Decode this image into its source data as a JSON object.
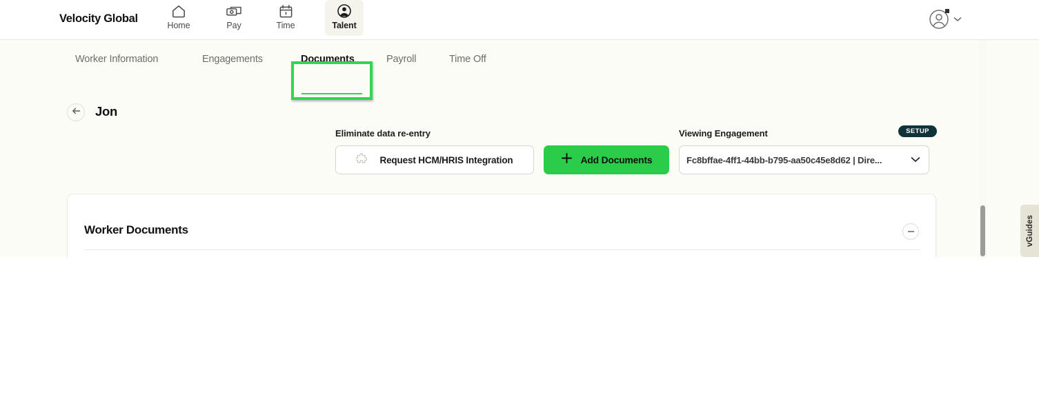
{
  "colors": {
    "page_background": "#fcfcf7",
    "nav_background": "#ffffff",
    "accent_green": "#2bcc4a",
    "highlight_green": "#2fd64f",
    "badge_dark_teal": "#10323a",
    "text_primary": "#121212",
    "text_muted": "#6d6d6a"
  },
  "topnav": {
    "brand": "Velocity Global",
    "items": [
      {
        "label": "Home",
        "icon": "home-icon",
        "active": false
      },
      {
        "label": "Pay",
        "icon": "money-icon",
        "active": false
      },
      {
        "label": "Time",
        "icon": "calendar-icon",
        "active": false
      },
      {
        "label": "Talent",
        "icon": "person-icon",
        "active": true
      }
    ],
    "account": {
      "icon": "user-avatar-icon",
      "chevron": "chevron-down-icon",
      "has_notification_dot": true
    }
  },
  "tabs": [
    {
      "label": "Worker Information",
      "active": false
    },
    {
      "label": "Engagements",
      "active": false
    },
    {
      "label": "Documents",
      "active": true
    },
    {
      "label": "Payroll",
      "active": false
    },
    {
      "label": "Time Off",
      "active": false
    }
  ],
  "page_header": {
    "back_icon": "arrow-left-icon",
    "worker_name": "Jon"
  },
  "actions": {
    "integration_label": "Eliminate data re-entry",
    "request_integration_button": {
      "label": "Request HCM/HRIS Integration",
      "icon": "puzzle-piece-icon"
    },
    "add_documents_button": {
      "label": "Add Documents",
      "icon": "plus-icon"
    }
  },
  "engagement": {
    "label": "Viewing Engagement",
    "badge": "SETUP",
    "selected_value": "Fc8bffae-4ff1-44bb-b795-aa50c45e8d62 | Dire...",
    "chevron": "chevron-down-icon"
  },
  "worker_documents_card": {
    "title": "Worker Documents",
    "collapse_icon": "minus-circle-icon"
  },
  "side_tab": {
    "label": "vGuides"
  }
}
